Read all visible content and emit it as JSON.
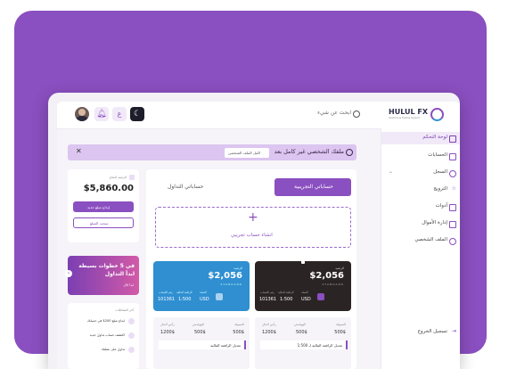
{
  "colors": {
    "brand": "#8a4fc0",
    "accent": "#7b3fb3",
    "dark_card": "#2b2424",
    "blue_card": "#2f8fd1"
  },
  "header": {
    "logo_text": "HULUL FX",
    "logo_sub": "Solutions & Trading Support",
    "search_placeholder": "ابحث عن شيء"
  },
  "sidebar": {
    "items": [
      {
        "label": "لوحة التحكم",
        "icon": "dashboard-icon"
      },
      {
        "label": "الحسابات",
        "icon": "accounts-icon"
      },
      {
        "label": "السجل",
        "icon": "history-icon"
      },
      {
        "label": "الترويج",
        "icon": "promotion-icon"
      },
      {
        "label": "أدوات",
        "icon": "tools-icon"
      },
      {
        "label": "إدارة الأموال",
        "icon": "funds-icon"
      },
      {
        "label": "الملف الشخصي",
        "icon": "profile-icon"
      }
    ],
    "logout_label": "تسجيل الخروج"
  },
  "alert": {
    "message": "ملفك الشخصي غير كامل بعد",
    "button_label": "اكمل الملف الشخصي"
  },
  "tabs": {
    "active": "حساباتي التجريبية",
    "inactive": "حساباتي التداول"
  },
  "create_account": {
    "label": "انشاء حساب تجريبي"
  },
  "cards": [
    {
      "balance": "$2,056",
      "type": "STANDARD",
      "currency": "USD",
      "leverage": "1:500",
      "number": "101361",
      "label_balance": "الرصيد",
      "label_currency": "العملة",
      "label_leverage": "الرافعة المالية",
      "label_number": "رقم الحساب",
      "theme": "dark"
    },
    {
      "balance": "$2,056",
      "type": "STANDARD",
      "currency": "USD",
      "leverage": "1:500",
      "number": "101361",
      "label_balance": "الرصيد",
      "label_currency": "العملة",
      "label_leverage": "الرافعة المالية",
      "label_number": "رقم الحساب",
      "theme": "blue"
    }
  ],
  "stats": [
    {
      "labels": [
        "السيولة",
        "الهوامش",
        "رأس المال"
      ],
      "values": [
        "500$",
        "500$",
        "1200$"
      ],
      "action": "تعديل الرافعة المالية لـ 1:500"
    },
    {
      "labels": [
        "السيولة",
        "الهوامش",
        "رأس المال"
      ],
      "values": [
        "500$",
        "500$",
        "1200$"
      ],
      "action": "تعديل الرافعة المالية"
    }
  ],
  "wallet": {
    "label": "الرصيد المتاح",
    "amount": "$5,860.00",
    "deposit_label": "إيداع مبلغ جديد",
    "withdraw_label": "سحب المبلغ"
  },
  "promo": {
    "line1": "في 5 خطوات بسيطة",
    "line2": "ابدأ التداول",
    "button": "ابدأ الآن"
  },
  "activity": {
    "title": "آخر النشاطات",
    "items": [
      "ايداع مبلغ 200$ في حسابك",
      "اكتشف حساب تداول جديد",
      "تداول على عملتك"
    ]
  }
}
